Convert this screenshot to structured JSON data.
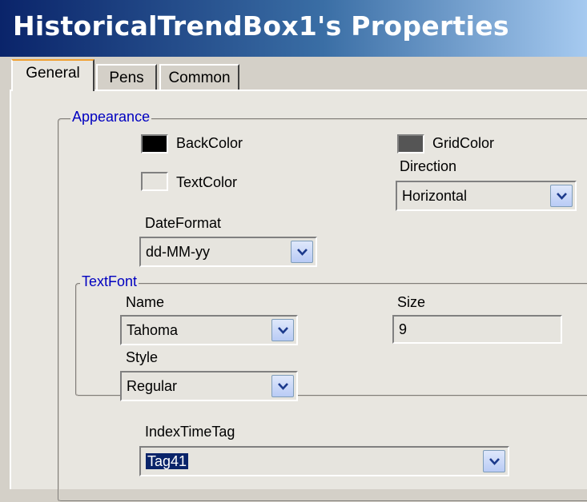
{
  "window": {
    "title": "HistoricalTrendBox1's Properties"
  },
  "tabs": [
    {
      "label": "General"
    },
    {
      "label": "Pens"
    },
    {
      "label": "Common"
    }
  ],
  "appearance": {
    "group_label": "Appearance",
    "back_color": {
      "label": "BackColor",
      "color": "#000000"
    },
    "grid_color": {
      "label": "GridColor",
      "color": "#555555"
    },
    "text_color": {
      "label": "TextColor",
      "color": "#e6e4de"
    },
    "direction": {
      "label": "Direction",
      "value": "Horizontal"
    },
    "date_format": {
      "label": "DateFormat",
      "value": "dd-MM-yy"
    }
  },
  "text_font": {
    "group_label": "TextFont",
    "name": {
      "label": "Name",
      "value": "Tahoma"
    },
    "size": {
      "label": "Size",
      "value": "9"
    },
    "style": {
      "label": "Style",
      "value": "Regular"
    }
  },
  "index_time_tag": {
    "label": "IndexTimeTag",
    "value": "Tag41"
  }
}
